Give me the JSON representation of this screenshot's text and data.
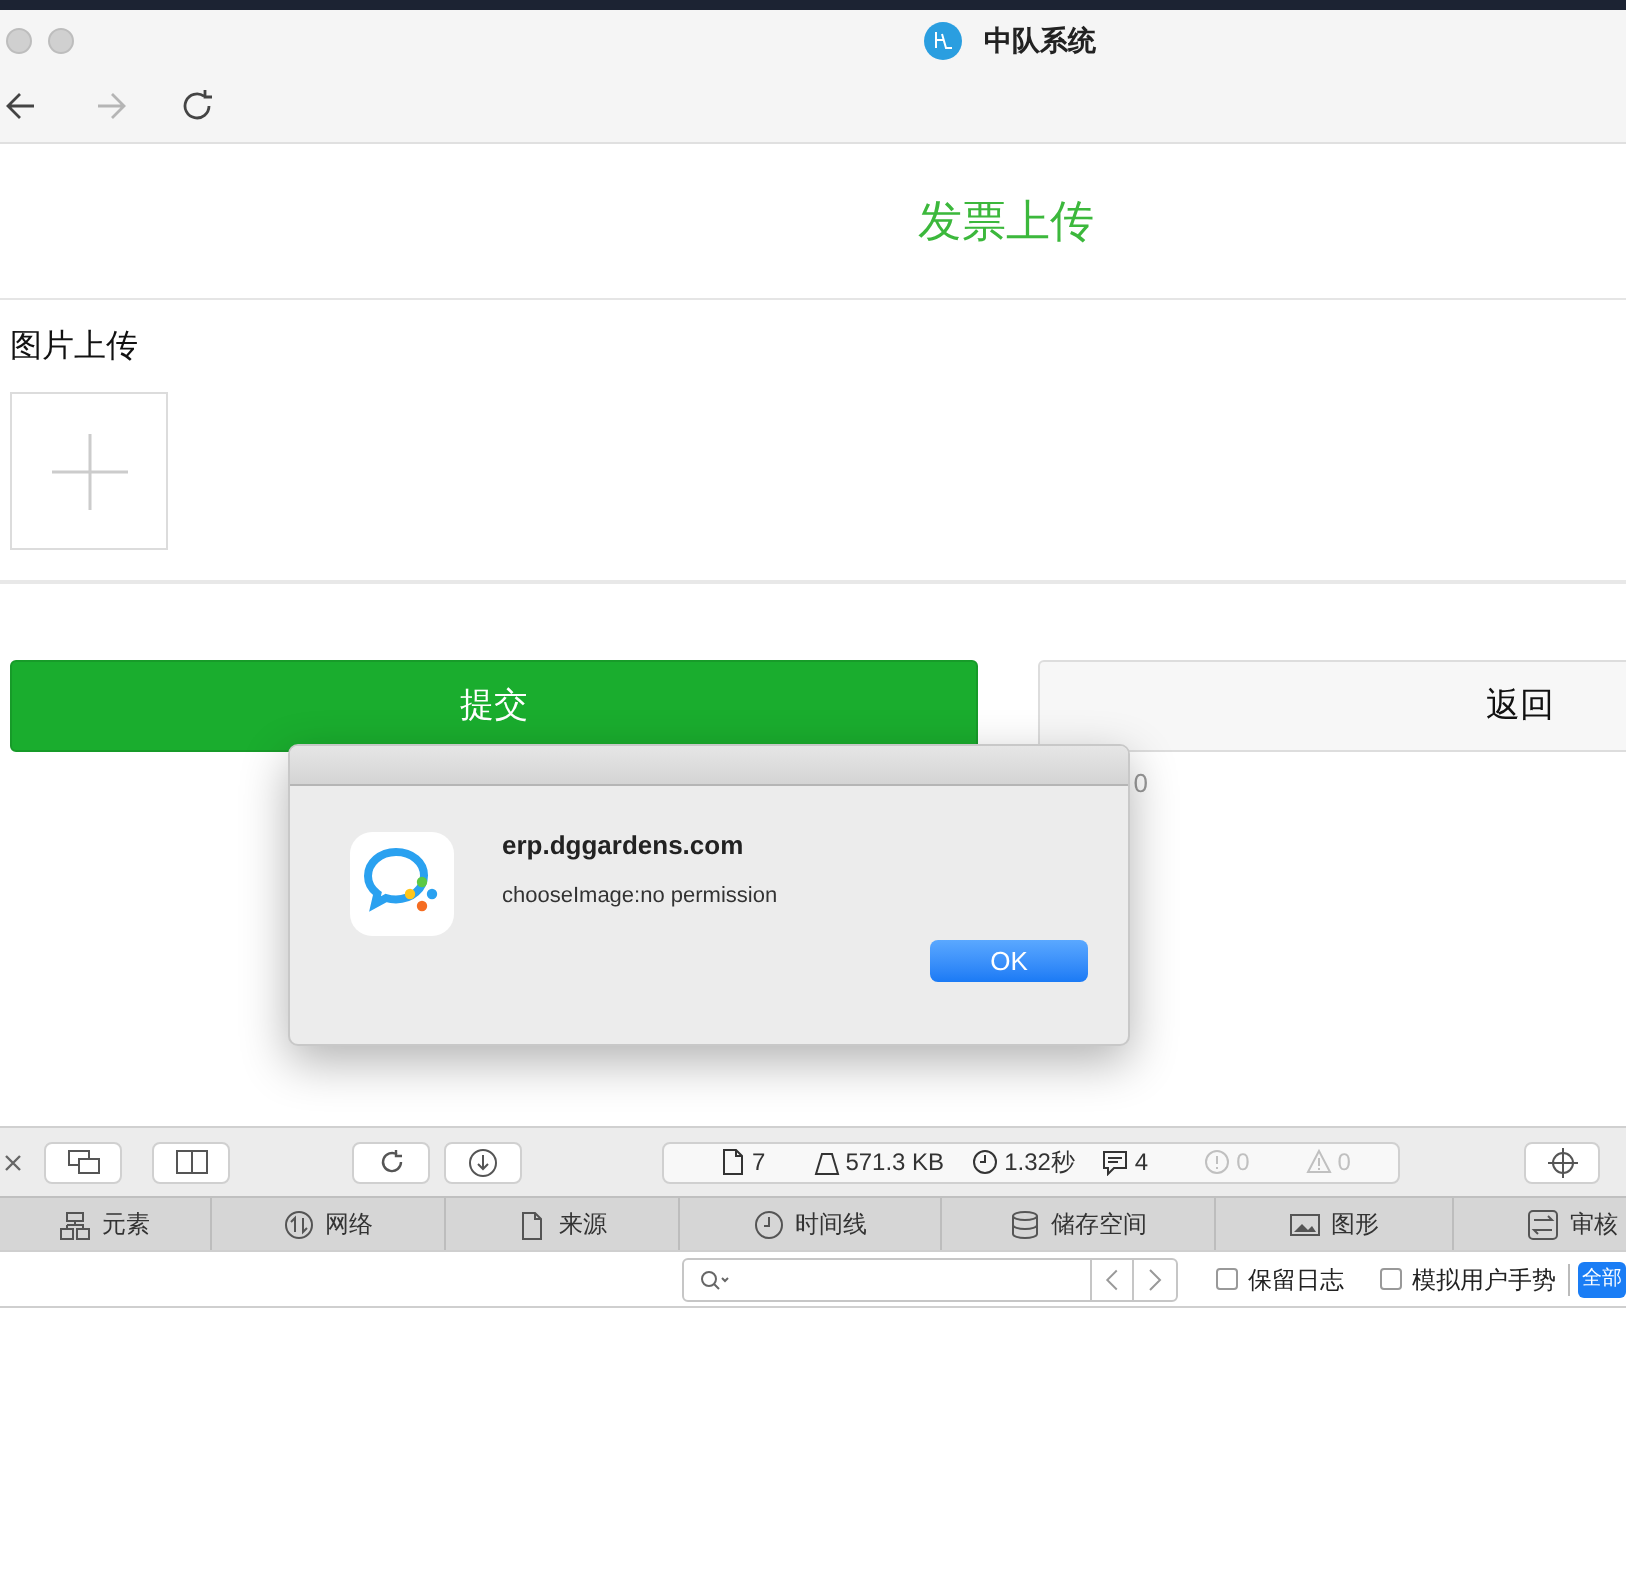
{
  "window": {
    "title": "中队系统"
  },
  "nav": [
    {
      "kind": "back",
      "disabled": false
    },
    {
      "kind": "forward",
      "disabled": true
    },
    {
      "kind": "reload",
      "disabled": false
    }
  ],
  "page": {
    "heading": "发票上传",
    "upload_label": "图片上传",
    "buttons": [
      {
        "label": "提交",
        "kind": "primary"
      },
      {
        "label": "返回",
        "kind": "secondary"
      }
    ],
    "partial_text": "0"
  },
  "dialog": {
    "title": "erp.dggardens.com",
    "message": "chooseImage:no permission",
    "button": "OK"
  },
  "devtools": {
    "stats": [
      {
        "text": "7",
        "disabled": false
      },
      {
        "text": "571.3 KB",
        "disabled": false
      },
      {
        "text": "1.32秒",
        "disabled": false
      },
      {
        "text": "4",
        "disabled": false
      },
      {
        "text": "0",
        "disabled": true
      },
      {
        "text": "0",
        "disabled": true
      }
    ],
    "tabs": [
      {
        "label": "元素"
      },
      {
        "label": "网络"
      },
      {
        "label": "来源"
      },
      {
        "label": "时间线"
      },
      {
        "label": "储存空间"
      },
      {
        "label": "图形"
      },
      {
        "label": "审核"
      }
    ],
    "checkboxes": [
      {
        "label": "保留日志",
        "checked": false
      },
      {
        "label": "模拟用户手势",
        "checked": false
      }
    ],
    "scope_button": "全部"
  }
}
